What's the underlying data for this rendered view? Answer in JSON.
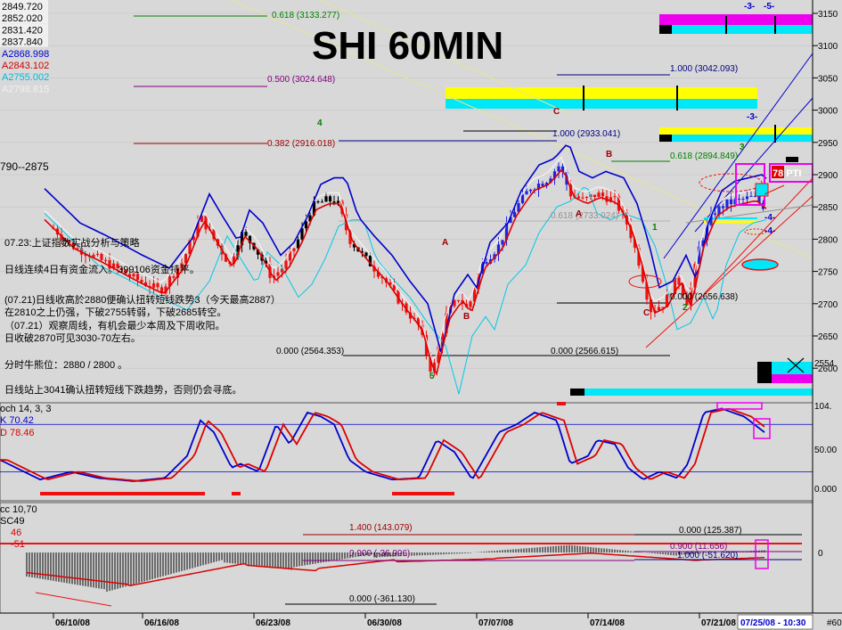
{
  "chart_data": {
    "type": "candlestick",
    "title": "SHI 60MIN",
    "price_axis": {
      "ticks": [
        "3150",
        "3100",
        "3050",
        "3000",
        "2950",
        "2900",
        "2850",
        "2800",
        "2750",
        "2700",
        "2650",
        "2600"
      ],
      "current": "2554."
    },
    "osc_axis": {
      "ticks": [
        "104.",
        "50.00",
        "0.000"
      ]
    },
    "macd_axis": {
      "ticks": [
        "0"
      ]
    },
    "date_axis": {
      "ticks": [
        "06/10/08",
        "06/16/08",
        "06/23/08",
        "06/30/08",
        "07/07/08",
        "07/14/08",
        "07/21/08"
      ],
      "last": "07/25/08 - 10:30",
      "corner": "#60"
    },
    "left_values": [
      {
        "text": "2849.720",
        "color": "#000000"
      },
      {
        "text": "2852.020",
        "color": "#000000"
      },
      {
        "text": "2831.420",
        "color": "#000000"
      },
      {
        "text": "2837.840",
        "color": "#000000"
      },
      {
        "text": "A2868.998",
        "color": "#0000cc"
      },
      {
        "text": "A2843.102",
        "color": "#d00000"
      },
      {
        "text": "A2755.002",
        "color": "#00b8d8"
      },
      {
        "text": "A2798.815",
        "color": "#f0f0f0"
      }
    ],
    "range_note": "790--2875",
    "fib_labels": [
      {
        "text": "0.618 (3133.277)",
        "color": "#008000"
      },
      {
        "text": "0.500 (3024.648)",
        "color": "#800080"
      },
      {
        "text": "0.382 (2916.018)",
        "color": "#a00000"
      },
      {
        "text": "1.000 (3042.093)",
        "color": "#000080"
      },
      {
        "text": "1.000 (2933.041)",
        "color": "#000080"
      },
      {
        "text": "0.618 (2894.849)",
        "color": "#008000"
      },
      {
        "text": "0.618 (2733.024)",
        "color": "#909090"
      },
      {
        "text": "0.000 (2656.638)",
        "color": "#000000"
      },
      {
        "text": "0.000 (2564.353)",
        "color": "#000000"
      },
      {
        "text": "0.000 (2566.615)",
        "color": "#000000"
      }
    ],
    "wave_labels": [
      "4",
      "5",
      "A",
      "B",
      "C",
      "A",
      "B",
      "C",
      "1",
      "2",
      "3",
      "-3-",
      "-5-",
      "-3-",
      "-4-",
      "-4-"
    ],
    "annotation_lines": [
      "07.23:上证指数实战分析与策略",
      "日线连续4日有资金流入。399106资金持平。",
      "(07.21)日线收高於2880便确认扭转短线跌势3（今天最高2887）",
      "在2810之上仍强，下破2755转弱，下破2685转空。",
      "（07.21）观察周线，有机会最少本周及下周收阳。",
      "日收破2870可见3030-70左右。",
      "分时牛熊位：2880 / 2800 。",
      "日线站上3041确认扭转短线下跌趋势，否则仍会寻底。"
    ],
    "pti_label": "78 PTI",
    "stoch_legend": {
      "name": "och 14, 3, 3",
      "k": "K  70.42",
      "d": "D  78.46"
    },
    "macd_legend": {
      "name": "cc 10,70",
      "sig": "SC49",
      "a": "46",
      "b": "-51"
    },
    "macd_labels": [
      {
        "text": "1.400 (143.079)",
        "color": "#a00000"
      },
      {
        "text": "0.900 (-36.996)",
        "color": "#800080"
      },
      {
        "text": "0.000 (125.387)",
        "color": "#000000"
      },
      {
        "text": "0.900 (11.656)",
        "color": "#800080"
      },
      {
        "text": "1.000 (-51.620)",
        "color": "#000080"
      },
      {
        "text": "0.000 (-361.130)",
        "color": "#000000"
      }
    ],
    "colors": {
      "bg": "#d8d8d8",
      "up": "#2222dd",
      "down": "#ee1111",
      "black": "#000000",
      "blue": "#0000cc",
      "red": "#dd0000",
      "cyan": "#00c8e8",
      "yellow": "#ffff00",
      "magenta": "#ee00ee"
    }
  }
}
